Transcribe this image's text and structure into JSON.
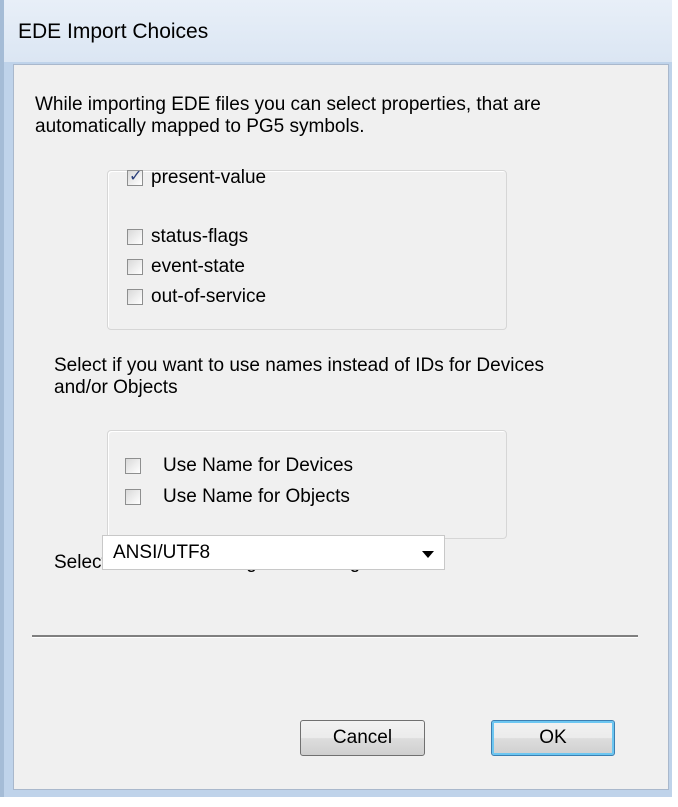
{
  "dialog": {
    "title": "EDE Import Choices",
    "intro_line1": "While importing EDE files you can select properties, that are",
    "intro_line2": "automatically mapped to PG5 symbols.",
    "properties": [
      {
        "label": "present-value",
        "checked": true
      },
      {
        "label": "status-flags",
        "checked": false
      },
      {
        "label": "event-state",
        "checked": false
      },
      {
        "label": "out-of-service",
        "checked": false
      }
    ],
    "names_line1": "Select if you want to use names instead of IDs for Devices",
    "names_line2": "and/or Objects",
    "name_options": [
      {
        "label": "Use Name for Devices",
        "checked": false
      },
      {
        "label": "Use Name for Objects",
        "checked": false
      }
    ],
    "encoding_label": "Select the text encoding for all string values",
    "encoding_value": "ANSI/UTF8",
    "buttons": {
      "cancel": "Cancel",
      "ok": "OK"
    }
  },
  "icons": {
    "dropdown": "chevron-down-icon",
    "check": "checkmark-icon"
  }
}
